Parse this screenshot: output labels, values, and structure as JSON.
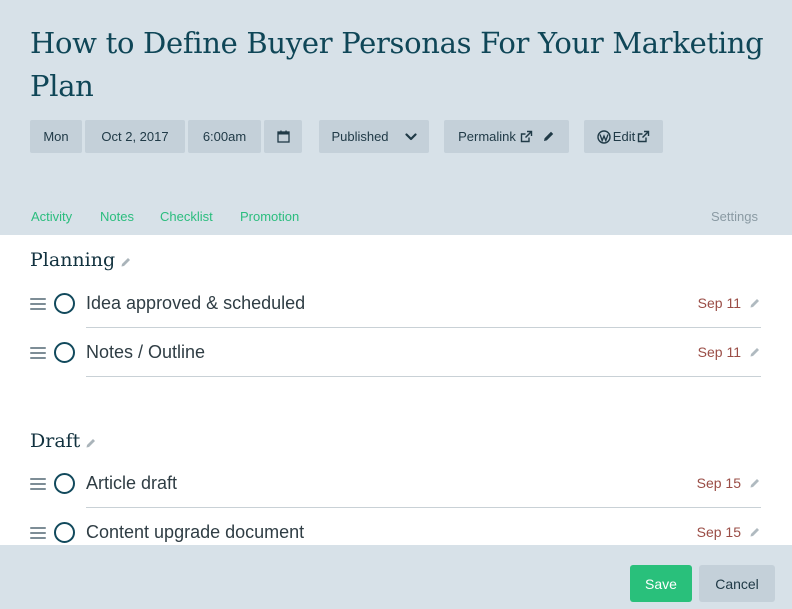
{
  "post": {
    "title": "How to Define Buyer Personas For Your Marketing Plan"
  },
  "meta": {
    "day": "Mon",
    "date": "Oct 2, 2017",
    "time": "6:00am",
    "status": "Published",
    "permalink_label": "Permalink",
    "edit_label": "Edit"
  },
  "tabs": {
    "activity": "Activity",
    "notes": "Notes",
    "checklist": "Checklist",
    "promotion": "Promotion",
    "settings": "Settings"
  },
  "sections": [
    {
      "title": "Planning",
      "tasks": [
        {
          "label": "Idea approved & scheduled",
          "date": "Sep 11"
        },
        {
          "label": "Notes / Outline",
          "date": "Sep 11"
        }
      ]
    },
    {
      "title": "Draft",
      "tasks": [
        {
          "label": "Article draft",
          "date": "Sep 15"
        },
        {
          "label": "Content upgrade document",
          "date": "Sep 15"
        }
      ]
    }
  ],
  "footer": {
    "save_label": "Save",
    "cancel_label": "Cancel"
  },
  "colors": {
    "accent_green": "#29c07b",
    "header_bg": "#d7e1e8",
    "chip_bg": "#c4d0d9",
    "title_color": "#0f4657",
    "date_color": "#9a4d46"
  },
  "icons": {
    "calendar": "calendar-icon",
    "status_dropdown": "chevron-down-icon",
    "external": "external-link-icon",
    "pencil": "pencil-icon",
    "wordpress": "wordpress-icon",
    "handle": "drag-handle-icon",
    "task_status": "circle-icon"
  }
}
